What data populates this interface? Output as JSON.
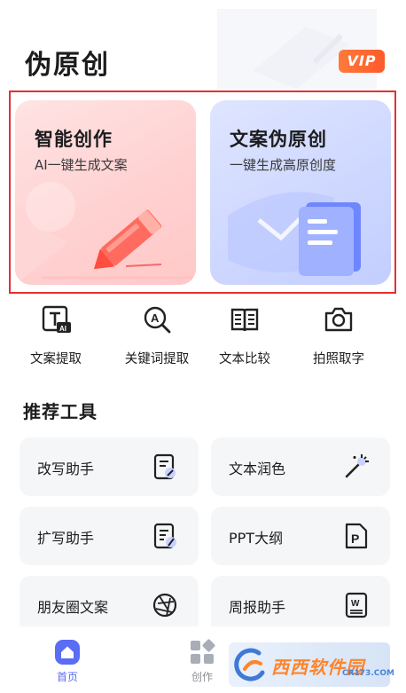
{
  "header": {
    "title": "伪原创",
    "vip_label": "VIP"
  },
  "feature_cards": [
    {
      "title": "智能创作",
      "subtitle": "AI一键生成文案"
    },
    {
      "title": "文案伪原创",
      "subtitle": "一键生成高原创度"
    }
  ],
  "shortcuts": [
    {
      "label": "文案提取",
      "icon": "text-ai-icon"
    },
    {
      "label": "关键词提取",
      "icon": "keyword-search-icon"
    },
    {
      "label": "文本比较",
      "icon": "book-compare-icon"
    },
    {
      "label": "拍照取字",
      "icon": "camera-icon"
    }
  ],
  "tools_section": {
    "title": "推荐工具",
    "items": [
      {
        "label": "改写助手",
        "icon": "rewrite-doc-icon"
      },
      {
        "label": "文本润色",
        "icon": "magic-wand-icon"
      },
      {
        "label": "扩写助手",
        "icon": "expand-doc-icon"
      },
      {
        "label": "PPT大纲",
        "icon": "ppt-file-icon"
      },
      {
        "label": "朋友圈文案",
        "icon": "aperture-icon"
      },
      {
        "label": "周报助手",
        "icon": "word-file-icon"
      }
    ]
  },
  "tabbar": {
    "tabs": [
      {
        "label": "首页",
        "icon": "home-icon",
        "active": true
      },
      {
        "label": "创作",
        "icon": "grid-icon",
        "active": false
      }
    ]
  },
  "watermark": {
    "text": "西西软件园",
    "sub": "CR173.COM"
  },
  "colors": {
    "accent_blue": "#5b6cf5",
    "vip_orange": "#ff6a33",
    "highlight_red": "#e53030"
  }
}
